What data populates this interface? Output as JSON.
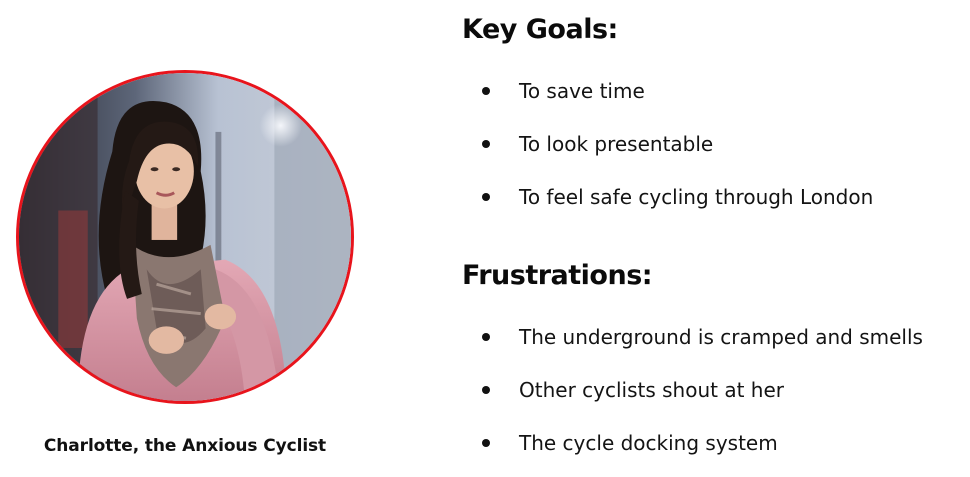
{
  "persona": {
    "caption": "Charlotte, the Anxious Cyclist",
    "photo_border_color": "#e8141c"
  },
  "goals": {
    "title": "Key Goals:",
    "items": [
      "To save time",
      "To look presentable",
      "To feel safe cycling through London"
    ]
  },
  "frustrations": {
    "title": "Frustrations:",
    "items": [
      "The underground is cramped and smells",
      "Other cyclists shout at her",
      "The cycle docking system"
    ]
  }
}
